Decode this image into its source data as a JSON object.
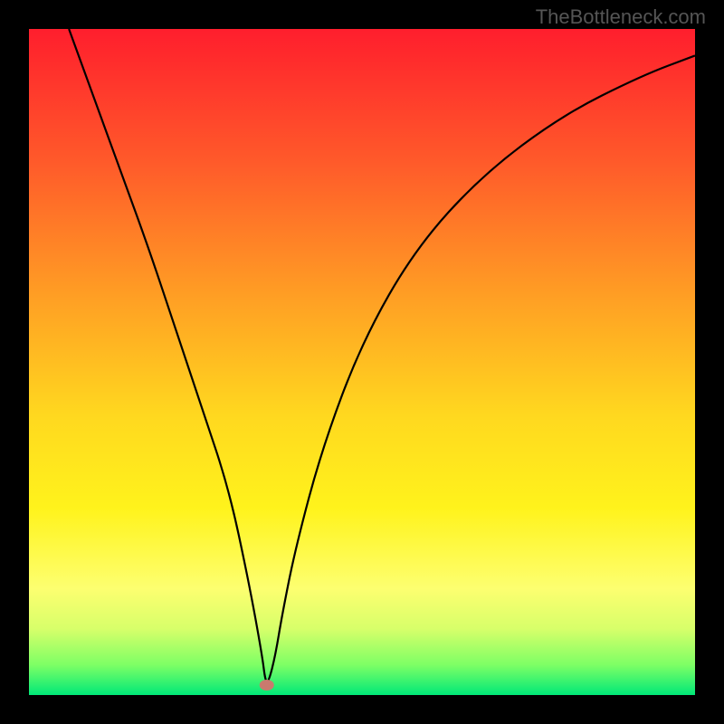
{
  "watermark": "TheBottleneck.com",
  "chart_data": {
    "type": "line",
    "title": "",
    "xlabel": "",
    "ylabel": "",
    "xlim": [
      0,
      100
    ],
    "ylim": [
      0,
      100
    ],
    "x": [
      6,
      10,
      14,
      18,
      22,
      26,
      30,
      33,
      35,
      35.5,
      36,
      37,
      38,
      40,
      44,
      50,
      58,
      68,
      80,
      92,
      100
    ],
    "y": [
      100,
      89,
      78,
      67,
      55,
      43,
      31,
      17,
      6,
      2,
      2,
      6,
      12,
      22,
      37,
      53,
      67,
      78,
      87,
      93,
      96
    ],
    "marker": {
      "x": 35.7,
      "y": 1.5,
      "color": "#c97a6e"
    },
    "gradient_stops": [
      {
        "offset": 0.0,
        "color": "#ff1e2d"
      },
      {
        "offset": 0.2,
        "color": "#ff5a2a"
      },
      {
        "offset": 0.4,
        "color": "#ff9e24"
      },
      {
        "offset": 0.58,
        "color": "#ffd81f"
      },
      {
        "offset": 0.72,
        "color": "#fff31c"
      },
      {
        "offset": 0.84,
        "color": "#fdff70"
      },
      {
        "offset": 0.9,
        "color": "#d8ff6a"
      },
      {
        "offset": 0.955,
        "color": "#7dff65"
      },
      {
        "offset": 1.0,
        "color": "#00e878"
      }
    ]
  }
}
